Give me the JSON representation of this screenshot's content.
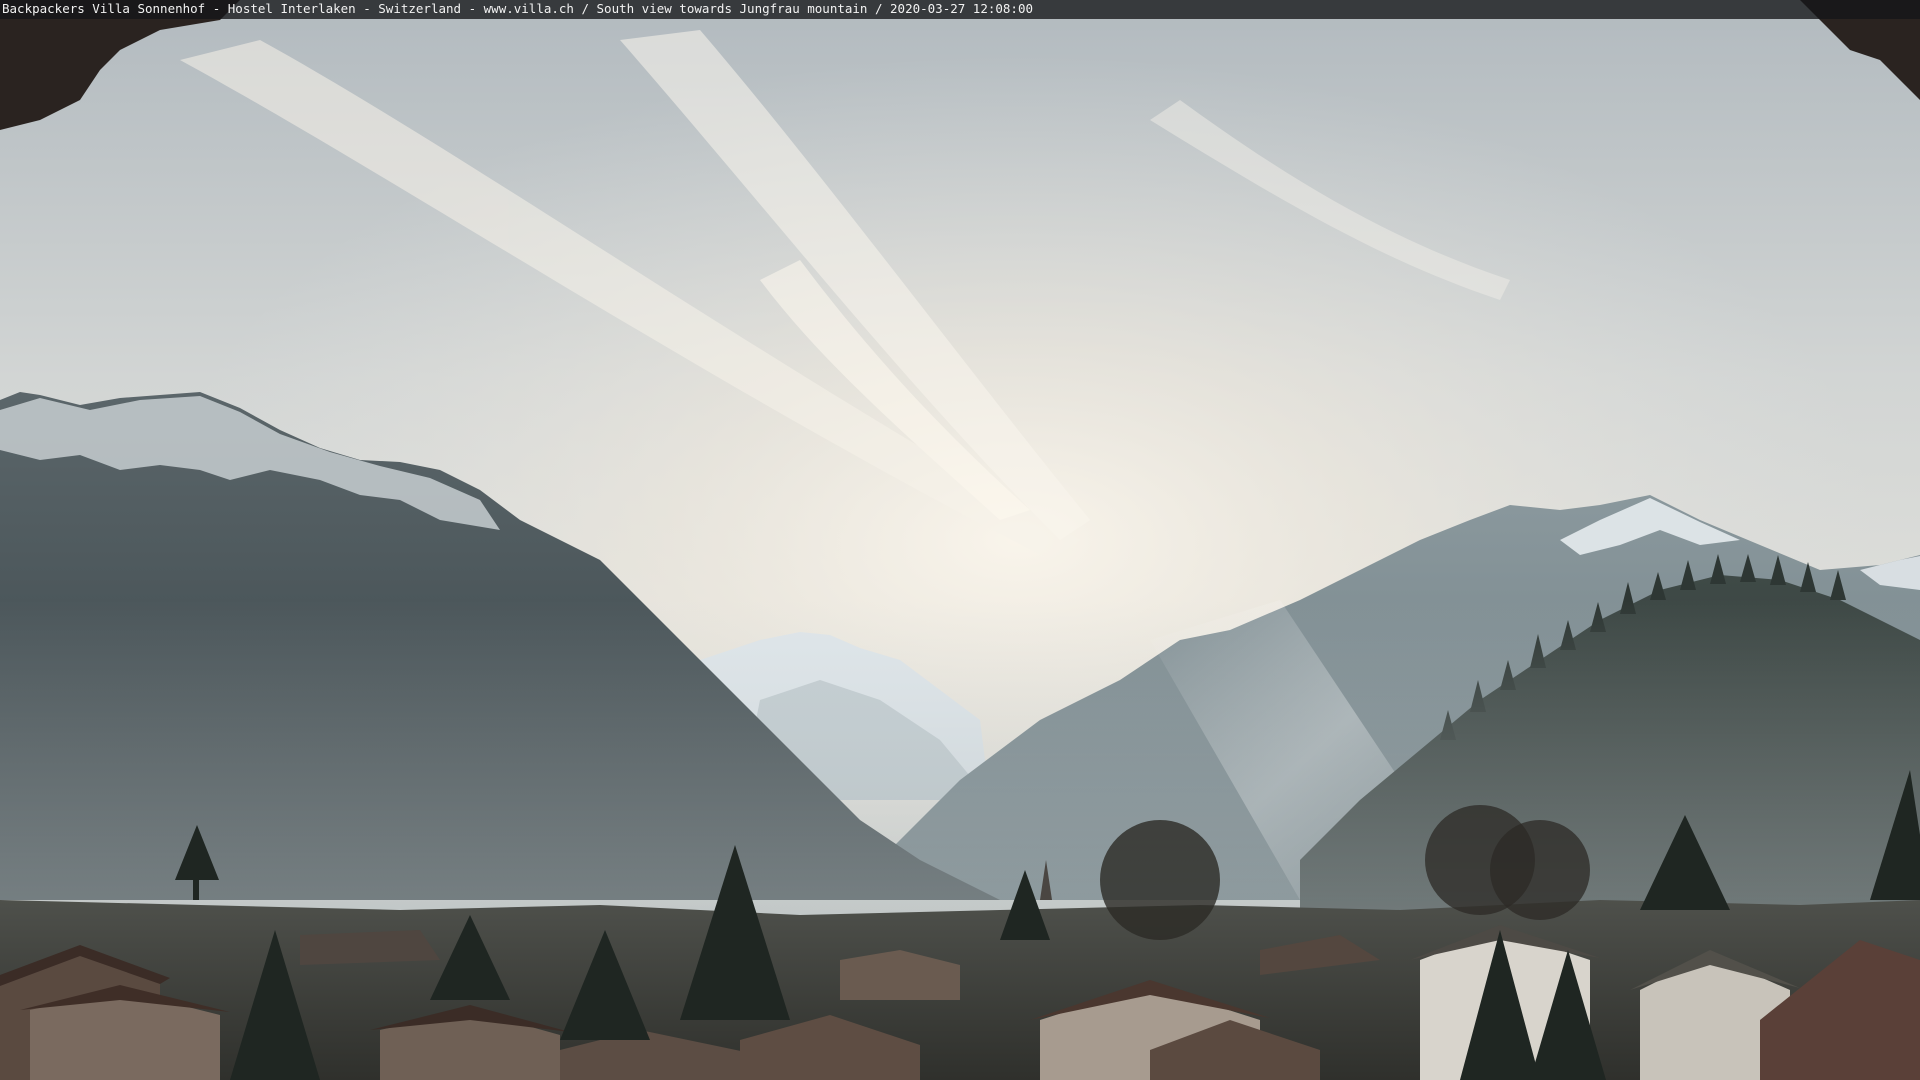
{
  "overlay": {
    "caption": "Backpackers Villa Sonnenhof - Hostel Interlaken - Switzerland - www.villa.ch / South view towards Jungfrau mountain / 2020-03-27 12:08:00"
  },
  "colors": {
    "sky_top": "#bcc4ca",
    "sky_glow": "#f4efe6",
    "mountain_left": "#3f4a4e",
    "mountain_right": "#66767c",
    "snow": "#e8ecef",
    "village_roof": "#3a2b26",
    "tree": "#1f2622"
  }
}
